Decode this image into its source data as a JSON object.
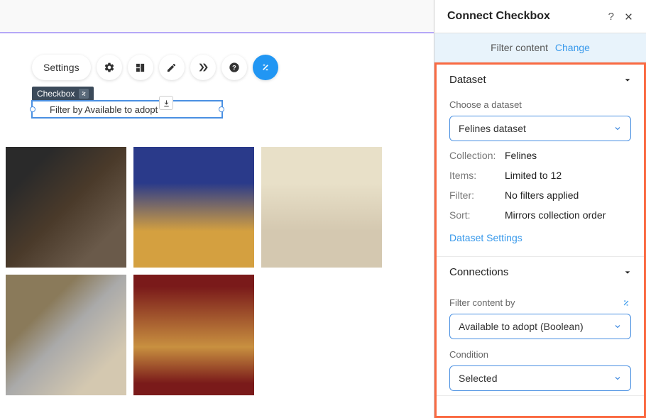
{
  "toolbar": {
    "settings_label": "Settings"
  },
  "element": {
    "type_label": "Checkbox",
    "text": "Filter by Available to adopt"
  },
  "panel": {
    "title": "Connect Checkbox",
    "filter_bar": {
      "label": "Filter content",
      "change": "Change"
    },
    "dataset_section": {
      "title": "Dataset",
      "choose_label": "Choose a dataset",
      "selected": "Felines dataset",
      "meta": {
        "collection_key": "Collection:",
        "collection_val": "Felines",
        "items_key": "Items:",
        "items_val": "Limited to 12",
        "filter_key": "Filter:",
        "filter_val": "No filters applied",
        "sort_key": "Sort:",
        "sort_val": "Mirrors collection order"
      },
      "settings_link": "Dataset Settings"
    },
    "connections_section": {
      "title": "Connections",
      "filter_by_label": "Filter content by",
      "filter_by_selected": "Available to adopt (Boolean)",
      "condition_label": "Condition",
      "condition_selected": "Selected"
    }
  }
}
